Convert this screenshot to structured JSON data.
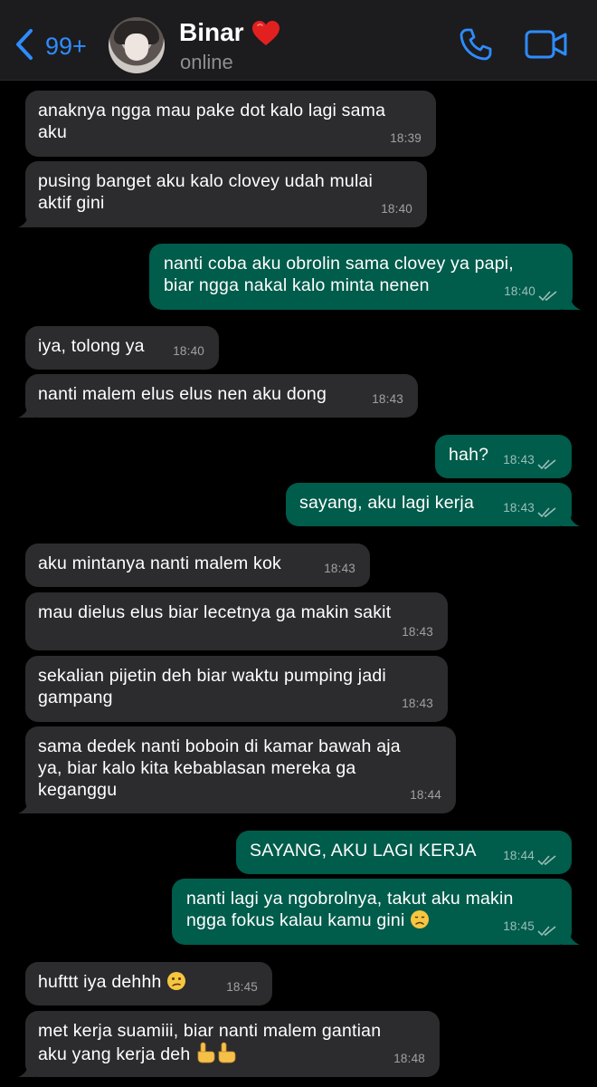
{
  "header": {
    "unread_count": "99+",
    "contact_name": "Binar",
    "status": "online",
    "accent_color": "#2e8cff"
  },
  "messages": [
    {
      "dir": "in",
      "text": "anaknya ngga mau pake dot kalo lagi sama\naku",
      "time": "18:39"
    },
    {
      "dir": "in",
      "text": "pusing banget aku kalo clovey udah mulai\naktif gini",
      "time": "18:40"
    },
    {
      "dir": "out",
      "text": "nanti coba aku obrolin sama clovey ya papi,\nbiar ngga nakal kalo minta nenen",
      "time": "18:40"
    },
    {
      "dir": "in",
      "text": "iya, tolong ya",
      "time": "18:40"
    },
    {
      "dir": "in",
      "text": "nanti malem elus elus nen aku dong",
      "time": "18:43"
    },
    {
      "dir": "out",
      "text": "hah?",
      "time": "18:43"
    },
    {
      "dir": "out",
      "text": "sayang, aku lagi kerja",
      "time": "18:43"
    },
    {
      "dir": "in",
      "text": "aku mintanya nanti malem kok",
      "time": "18:43"
    },
    {
      "dir": "in",
      "text": "mau dielus elus biar lecetnya ga makin sakit",
      "time": "18:43"
    },
    {
      "dir": "in",
      "text": "sekalian pijetin deh biar waktu pumping jadi\ngampang",
      "time": "18:43"
    },
    {
      "dir": "in",
      "text": "sama dedek nanti boboin di kamar bawah aja\nya, biar kalo kita kebablasan mereka ga\nkeganggu",
      "time": "18:44"
    },
    {
      "dir": "out",
      "text": "SAYANG, AKU LAGI KERJA",
      "time": "18:44"
    },
    {
      "dir": "out",
      "text": "nanti lagi ya ngobrolnya, takut aku makin\nngga fokus kalau kamu gini",
      "time": "18:45",
      "emoji": "disappointed-face"
    },
    {
      "dir": "in",
      "text": "hufttt iya dehhh",
      "time": "18:45",
      "emoji": "confused-face"
    },
    {
      "dir": "in",
      "text": "met kerja suamiii, biar nanti malem gantian\naku yang kerja deh",
      "time": "18:48",
      "emoji": "pointing-up-hands"
    }
  ]
}
